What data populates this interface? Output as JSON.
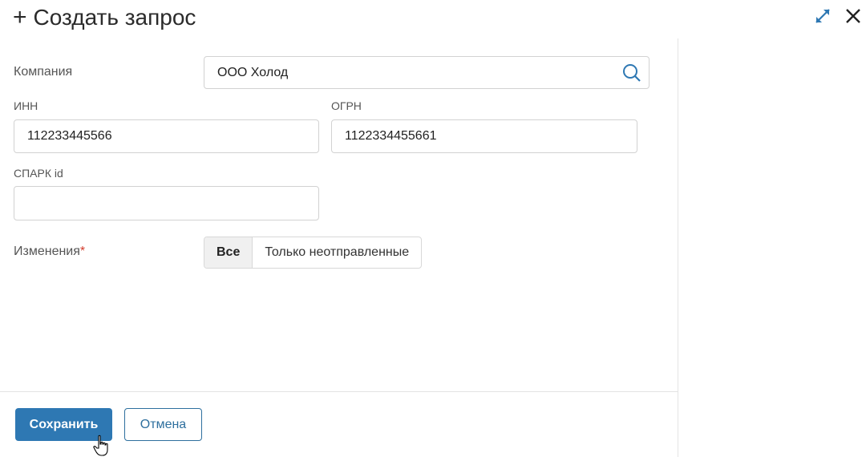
{
  "dialog": {
    "title_icon": "+",
    "title": "Создать запрос",
    "expand_icon": "expand-icon",
    "close_icon": "close-icon"
  },
  "form": {
    "company": {
      "label": "Компания",
      "value": "ООО Холод",
      "icon": "search-icon"
    },
    "inn": {
      "label": "ИНН",
      "value": "112233445566"
    },
    "ogrn": {
      "label": "ОГРН",
      "value": "1122334455661"
    },
    "spark": {
      "label": "СПАРК id",
      "value": ""
    },
    "changes": {
      "label": "Изменения",
      "required_mark": "*",
      "options": [
        "Все",
        "Только неотправленные"
      ],
      "selected": "Все"
    }
  },
  "footer": {
    "save_label": "Сохранить",
    "cancel_label": "Отмена"
  },
  "colors": {
    "primary": "#2e78b3",
    "required": "#d33c2c",
    "border": "#d2d2d2"
  }
}
